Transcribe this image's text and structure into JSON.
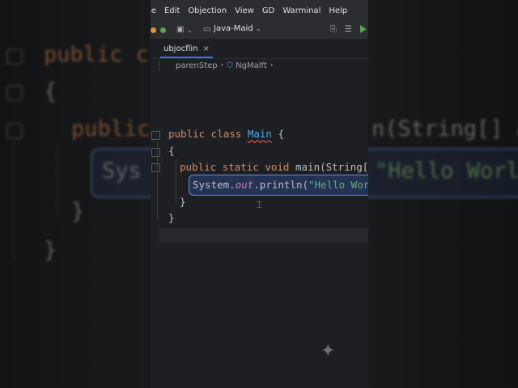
{
  "menu": [
    "le",
    "Edit",
    "Objection",
    "View",
    "GD",
    "Warminal",
    "Help"
  ],
  "toolbar": {
    "project": "Java-Maid"
  },
  "tab": {
    "label": "ubjocflin",
    "close": "×"
  },
  "breadcrumb": {
    "first": "parenStep",
    "second": "NgMalft"
  },
  "code": {
    "l1_kw": "public class ",
    "l1_cls": "Main",
    "l1_end": " {",
    "l2": "{",
    "l3_kw": "public static void ",
    "l3_rest": "main(String[] a",
    "l4_a": "System.",
    "l4_out": "out",
    "l4_b": ".println(",
    "l4_str": "\"Hello World",
    "l5": "}",
    "l6": "}"
  },
  "background": {
    "left_l1": "public c",
    "left_l2": "{",
    "left_l3": "public",
    "left_l4": "Sys",
    "left_l5": "}",
    "left_l6": "}",
    "right_l3": "n(String[] a",
    "right_l4": "\"Hello World"
  },
  "colors": {
    "accent": "#3574f0",
    "keyword": "#cf8e6d",
    "string": "#6aab73",
    "class_name": "#56a8f5",
    "editor_bg": "#1e1f22"
  },
  "icons": [
    "file-icon",
    "chevron-down-icon",
    "new-file-icon",
    "list-icon",
    "run-icon",
    "close-icon",
    "chevron-right-icon",
    "class-icon",
    "sparkle-icon",
    "text-cursor-icon"
  ]
}
